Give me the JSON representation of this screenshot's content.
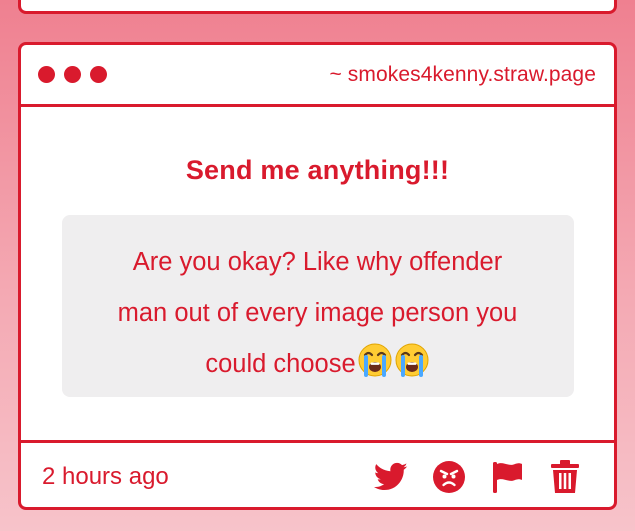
{
  "header": {
    "url": "~ smokes4kenny.straw.page"
  },
  "body": {
    "title": "Send me anything!!!",
    "message_lines": [
      "Are you okay? Like why offender",
      "man out of every image person you",
      "could choose"
    ],
    "emoji_icons": [
      "loudly-crying-face-icon",
      "loudly-crying-face-icon"
    ]
  },
  "footer": {
    "timestamp": "2 hours ago",
    "actions": [
      "twitter-icon",
      "angry-face-icon",
      "flag-icon",
      "trash-icon"
    ]
  },
  "colors": {
    "accent": "#d91a2d",
    "message_bg": "#efeeef",
    "background_top": "#ef8090",
    "background_bottom": "#f7c3ca"
  }
}
